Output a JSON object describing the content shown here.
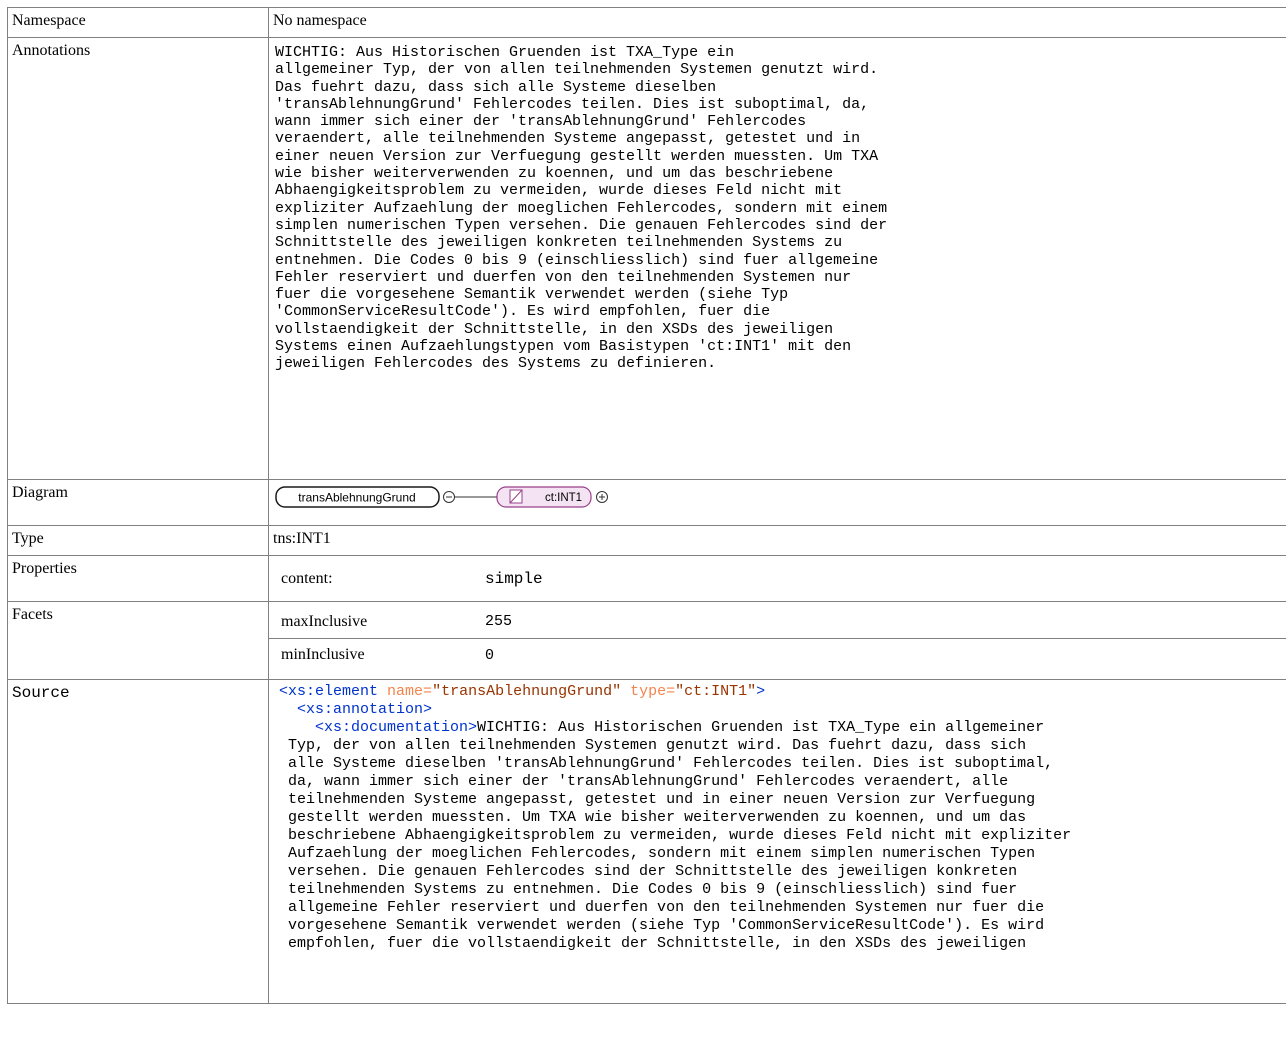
{
  "rows": {
    "namespace": {
      "label": "Namespace",
      "value": "No namespace"
    },
    "annotations": {
      "label": "Annotations",
      "text": "WICHTIG: Aus Historischen Gruenden ist TXA_Type ein\nallgemeiner Typ, der von allen teilnehmenden Systemen genutzt wird.\nDas fuehrt dazu, dass sich alle Systeme dieselben\n'transAblehnungGrund' Fehlercodes teilen. Dies ist suboptimal, da,\nwann immer sich einer der 'transAblehnungGrund' Fehlercodes\nveraendert, alle teilnehmenden Systeme angepasst, getestet und in\neiner neuen Version zur Verfuegung gestellt werden muessten. Um TXA\nwie bisher weiterverwenden zu koennen, und um das beschriebene\nAbhaengigkeitsproblem zu vermeiden, wurde dieses Feld nicht mit\nexpliziter Aufzaehlung der moeglichen Fehlercodes, sondern mit einem\nsimplen numerischen Typen versehen. Die genauen Fehlercodes sind der\nSchnittstelle des jeweiligen konkreten teilnehmenden Systems zu\nentnehmen. Die Codes 0 bis 9 (einschliesslich) sind fuer allgemeine\nFehler reserviert und duerfen von den teilnehmenden Systemen nur\nfuer die vorgesehene Semantik verwendet werden (siehe Typ\n'CommonServiceResultCode'). Es wird empfohlen, fuer die\nvollstaendigkeit der Schnittstelle, in den XSDs des jeweiligen\nSystems einen Aufzaehlungstypen vom Basistypen 'ct:INT1' mit den\njeweiligen Fehlercodes des Systems zu definieren."
    },
    "diagram": {
      "label": "Diagram",
      "element_name": "transAblehnungGrund",
      "type_name": "ct:INT1"
    },
    "type": {
      "label": "Type",
      "value": "tns:INT1"
    },
    "properties": {
      "label": "Properties",
      "items": [
        {
          "key": "content:",
          "value": "simple"
        }
      ]
    },
    "facets": {
      "label": "Facets",
      "items": [
        {
          "key": "maxInclusive",
          "value": "255"
        },
        {
          "key": "minInclusive",
          "value": "0"
        }
      ]
    },
    "source": {
      "label": "Source",
      "open_tag": "<xs:element",
      "attr1_name": "name=",
      "attr1_value": "\"transAblehnungGrund\"",
      "attr2_name": "type=",
      "attr2_value": "\"ct:INT1\"",
      "open_tag_close": ">",
      "annotation_tag": "<xs:annotation>",
      "documentation_tag": "<xs:documentation>",
      "doc_text": "WICHTIG: Aus Historischen Gruenden ist TXA_Type ein allgemeiner\n Typ, der von allen teilnehmenden Systemen genutzt wird. Das fuehrt dazu, dass sich\n alle Systeme dieselben 'transAblehnungGrund' Fehlercodes teilen. Dies ist suboptimal,\n da, wann immer sich einer der 'transAblehnungGrund' Fehlercodes veraendert, alle\n teilnehmenden Systeme angepasst, getestet und in einer neuen Version zur Verfuegung\n gestellt werden muessten. Um TXA wie bisher weiterverwenden zu koennen, und um das\n beschriebene Abhaengigkeitsproblem zu vermeiden, wurde dieses Feld nicht mit expliziter\n Aufzaehlung der moeglichen Fehlercodes, sondern mit einem simplen numerischen Typen\n versehen. Die genauen Fehlercodes sind der Schnittstelle des jeweiligen konkreten\n teilnehmenden Systems zu entnehmen. Die Codes 0 bis 9 (einschliesslich) sind fuer\n allgemeine Fehler reserviert und duerfen von den teilnehmenden Systemen nur fuer die\n vorgesehene Semantik verwendet werden (siehe Typ 'CommonServiceResultCode'). Es wird\n empfohlen, fuer die vollstaendigkeit der Schnittstelle, in den XSDs des jeweiligen"
    }
  },
  "colors": {
    "border": "#808080",
    "tag": "#0033cc",
    "attr_name": "#f5844c",
    "attr_value": "#993300",
    "type_box_fill": "#f3e3f3",
    "type_box_stroke": "#9a3f8a"
  },
  "icons": {
    "collapse": "minus-circle-icon",
    "expand": "plus-circle-icon",
    "simple_type": "simple-type-icon"
  }
}
